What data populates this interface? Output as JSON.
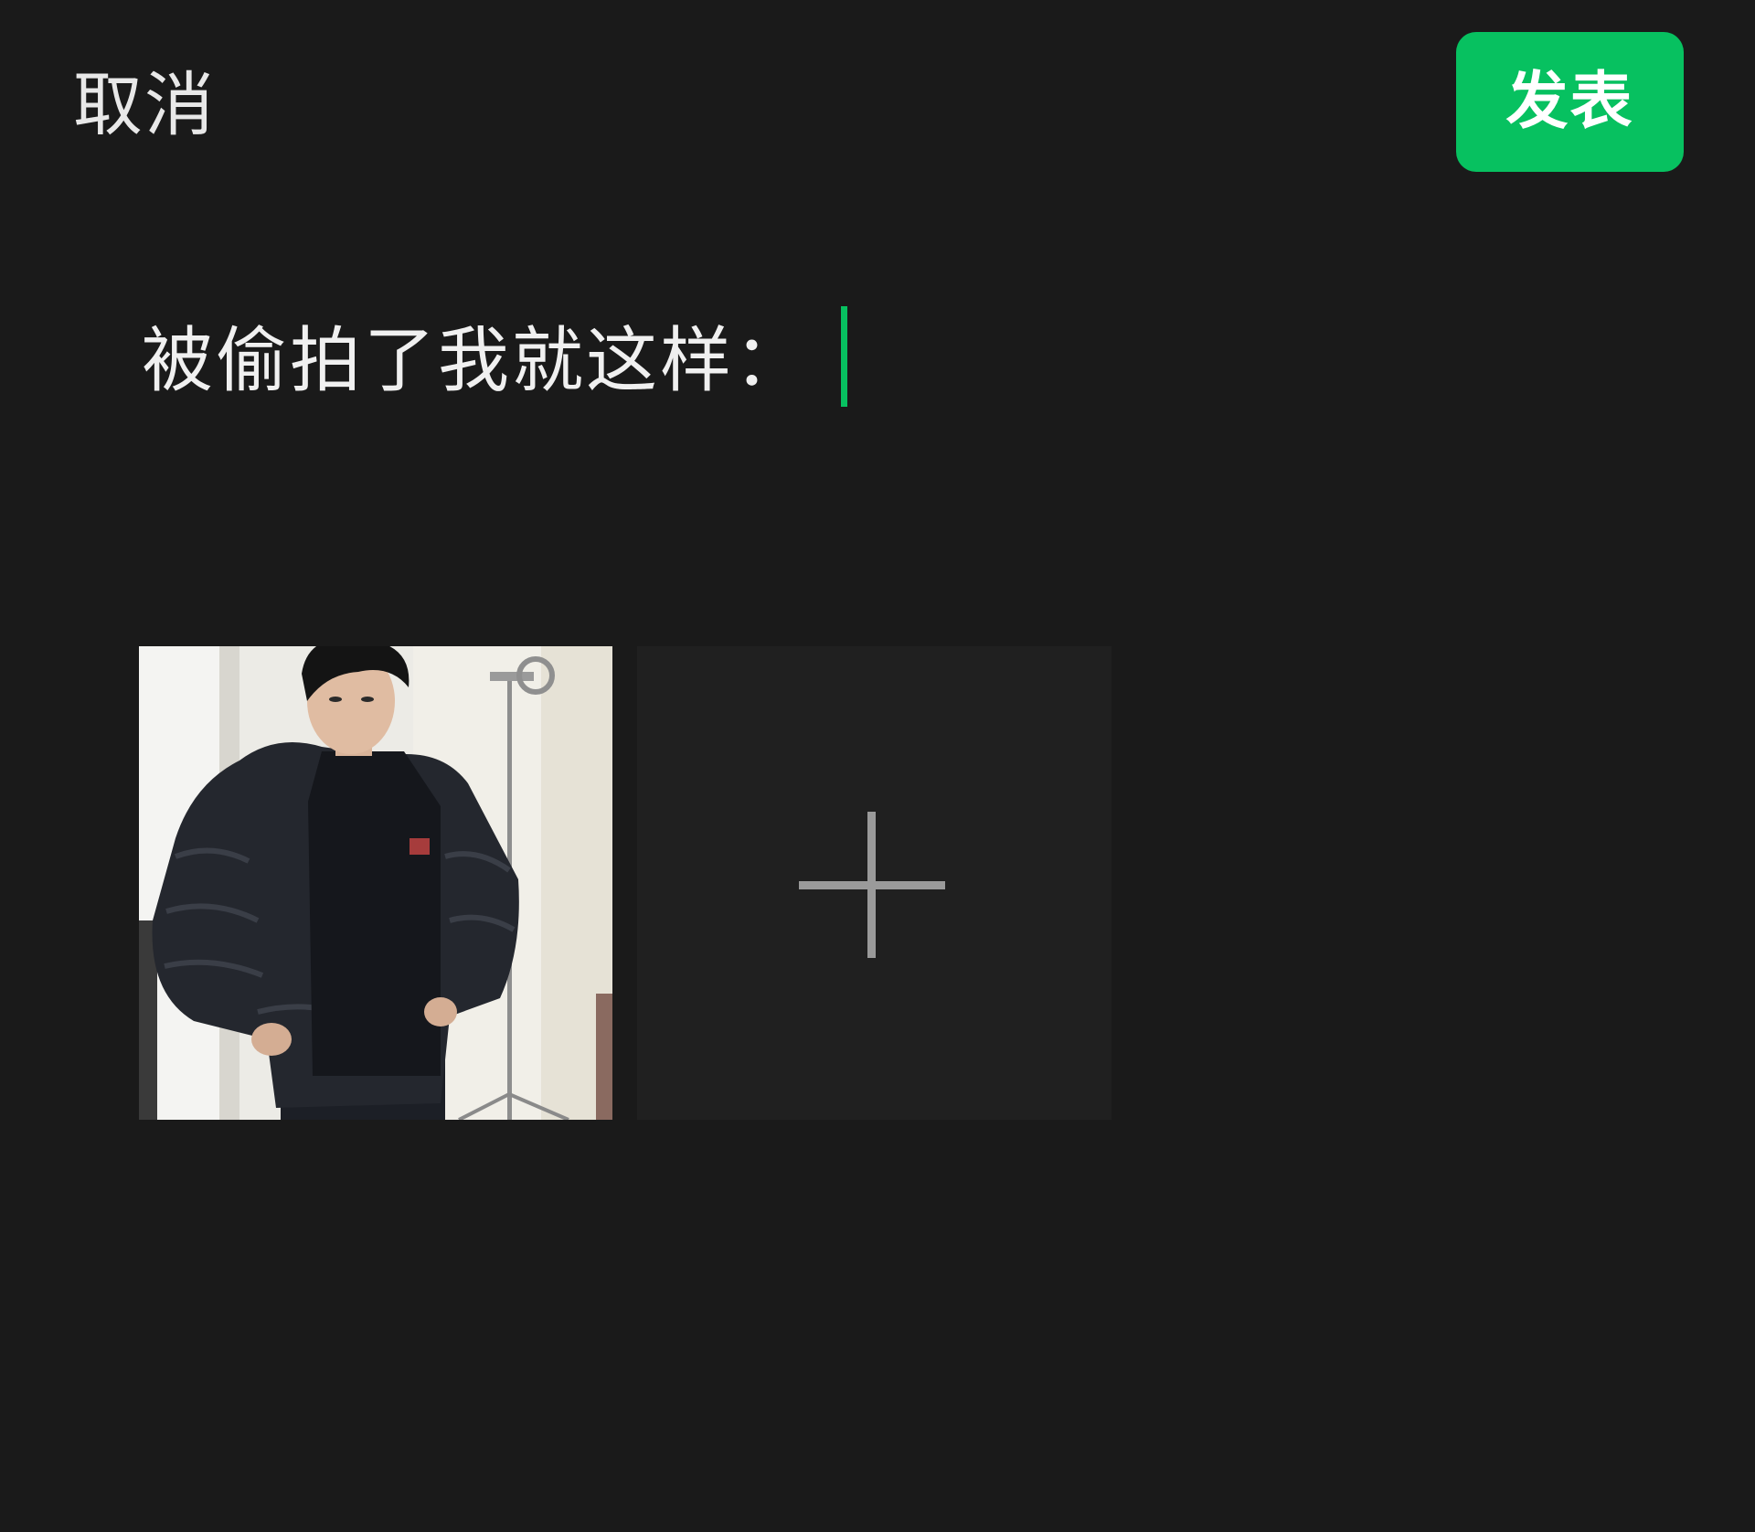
{
  "header": {
    "cancel_label": "取消",
    "publish_label": "发表"
  },
  "composer": {
    "text": "被偷拍了我就这样："
  },
  "media": {
    "photos": [
      {
        "icon": "photo-person-in-black-puffer-jacket"
      }
    ],
    "add_tile_icon": "plus-icon"
  },
  "colors": {
    "background": "#1a1a1a",
    "accent": "#07c160",
    "add_tile": "#202020"
  }
}
